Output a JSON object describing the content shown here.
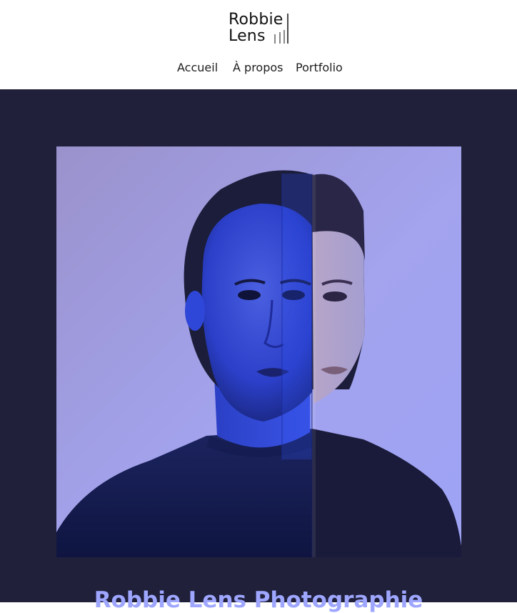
{
  "header": {
    "logo": {
      "line1": "Robbie",
      "line2": "Lens"
    },
    "nav": [
      {
        "label": "Accueil"
      },
      {
        "label": "À propos"
      },
      {
        "label": "Portfolio"
      }
    ]
  },
  "hero": {
    "title": "Robbie Lens Photographie",
    "photo_icon": "portrait-photo"
  },
  "colors": {
    "hero_background": "#20203a",
    "title_color": "#9ea6ff",
    "header_background": "#ffffff"
  }
}
